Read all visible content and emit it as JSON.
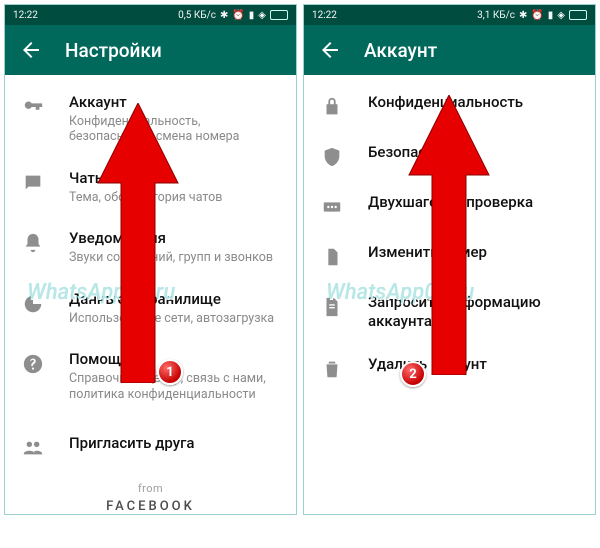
{
  "left": {
    "status": {
      "time": "12:22",
      "right_text": "0,5 КБ/с"
    },
    "header": {
      "title": "Настройки"
    },
    "items": [
      {
        "icon": "key",
        "title": "Аккаунт",
        "sub": "Конфиденциальность, безопасность, смена номера"
      },
      {
        "icon": "chat",
        "title": "Чаты",
        "sub": "Тема, обои, история чатов"
      },
      {
        "icon": "bell",
        "title": "Уведомления",
        "sub": "Звуки сообщений, групп и звонков"
      },
      {
        "icon": "data",
        "title": "Данные и хранилище",
        "sub": "Использование сети, автозагрузка"
      },
      {
        "icon": "help",
        "title": "Помощь",
        "sub": "Справочный центр, связь с нами, политика конфиденциальности"
      },
      {
        "icon": "group",
        "title": "Пригласить друга",
        "sub": ""
      }
    ],
    "footer": {
      "from": "from",
      "brand": "FACEBOOK"
    },
    "watermark": "WhatsApp03.ru",
    "badge": "1"
  },
  "right": {
    "status": {
      "time": "12:22",
      "right_text": "3,1 КБ/с"
    },
    "header": {
      "title": "Аккаунт"
    },
    "items": [
      {
        "icon": "lock",
        "title": "Конфиденциальность",
        "sub": ""
      },
      {
        "icon": "shield",
        "title": "Безопасность",
        "sub": ""
      },
      {
        "icon": "twostep",
        "title": "Двухшаговая проверка",
        "sub": ""
      },
      {
        "icon": "sim",
        "title": "Изменить номер",
        "sub": ""
      },
      {
        "icon": "doc",
        "title": "Запросить информацию аккаунта",
        "sub": ""
      },
      {
        "icon": "trash",
        "title": "Удалить аккаунт",
        "sub": ""
      }
    ],
    "watermark": "WhatsApp03.ru",
    "badge": "2"
  }
}
